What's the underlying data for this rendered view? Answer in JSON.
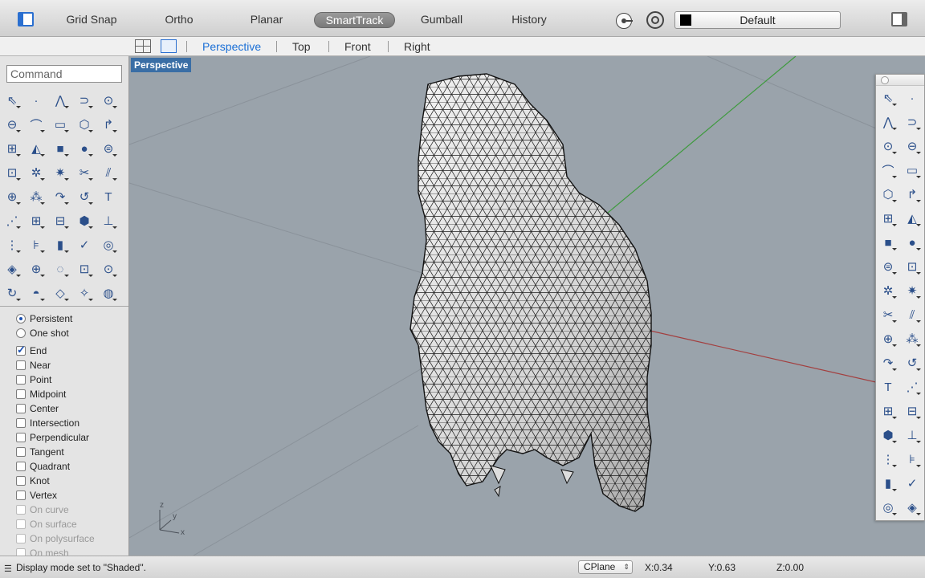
{
  "toolbar": {
    "buttons": [
      {
        "label": "Grid Snap",
        "active": false
      },
      {
        "label": "Ortho",
        "active": false
      },
      {
        "label": "Planar",
        "active": false
      },
      {
        "label": "SmartTrack",
        "active": true
      },
      {
        "label": "Gumball",
        "active": false
      },
      {
        "label": "History",
        "active": false
      }
    ],
    "layer": "Default"
  },
  "viewport_tabs": [
    "Perspective",
    "Top",
    "Front",
    "Right"
  ],
  "command": {
    "placeholder": "Command"
  },
  "osnap": {
    "modes": [
      {
        "label": "Persistent",
        "selected": true
      },
      {
        "label": "One shot",
        "selected": false
      }
    ],
    "items": [
      {
        "label": "End",
        "checked": true,
        "enabled": true
      },
      {
        "label": "Near",
        "checked": false,
        "enabled": true
      },
      {
        "label": "Point",
        "checked": false,
        "enabled": true
      },
      {
        "label": "Midpoint",
        "checked": false,
        "enabled": true
      },
      {
        "label": "Center",
        "checked": false,
        "enabled": true
      },
      {
        "label": "Intersection",
        "checked": false,
        "enabled": true
      },
      {
        "label": "Perpendicular",
        "checked": false,
        "enabled": true
      },
      {
        "label": "Tangent",
        "checked": false,
        "enabled": true
      },
      {
        "label": "Quadrant",
        "checked": false,
        "enabled": true
      },
      {
        "label": "Knot",
        "checked": false,
        "enabled": true
      },
      {
        "label": "Vertex",
        "checked": false,
        "enabled": true
      },
      {
        "label": "On curve",
        "checked": false,
        "enabled": false
      },
      {
        "label": "On surface",
        "checked": false,
        "enabled": false
      },
      {
        "label": "On polysurface",
        "checked": false,
        "enabled": false
      },
      {
        "label": "On mesh",
        "checked": false,
        "enabled": false
      }
    ]
  },
  "viewport": {
    "label": "Perspective",
    "axis_labels": {
      "z": "z",
      "y": "y",
      "x": "x"
    }
  },
  "left_tools": [
    "select-arrow-icon",
    "point-icon",
    "polyline-icon",
    "curve-icon",
    "circle-icon",
    "ellipse-icon",
    "arc-icon",
    "rectangle-icon",
    "polygon-icon",
    "fillet-icon",
    "surface-points-icon",
    "surface-edge-icon",
    "box-icon",
    "sphere-icon",
    "cylinder-icon",
    "mesh-icon",
    "gear-icon",
    "explode-icon",
    "trim-icon",
    "split-icon",
    "boolean-icon",
    "group-icon",
    "curve-tools-icon",
    "rebuild-icon",
    "text-icon",
    "control-points-icon",
    "array-icon",
    "layout-icon",
    "block-icon",
    "dimension-icon",
    "grid-icon",
    "align-icon",
    "solid-tools-icon",
    "check-icon",
    "analyze-icon",
    "render-icon",
    "zoom-in-icon",
    "zoom-window-icon",
    "zoom-extents-icon",
    "zoom-selected-icon",
    "rotate-view-icon",
    "car-icon",
    "plane-icon",
    "light-color-icon",
    "light-bulb-icon"
  ],
  "left_tool_glyphs": [
    "⇖",
    "·",
    "⋀",
    "⊃",
    "⊙",
    "⊖",
    "⌒",
    "▭",
    "⬡",
    "↱",
    "⊞",
    "◭",
    "■",
    "●",
    "⊜",
    "⊡",
    "✲",
    "✷",
    "✂",
    "⫽",
    "⊕",
    "⁂",
    "↷",
    "↺",
    "T",
    "⋰",
    "⊞",
    "⊟",
    "⬢",
    "⊥",
    "⋮",
    "⊧",
    "▮",
    "✓",
    "◎",
    "◈",
    "⊕",
    "◌",
    "⊡",
    "⊙",
    "↻",
    "◓",
    "◇",
    "✧",
    "◍"
  ],
  "right_tools": [
    "select-arrow-icon",
    "point-icon",
    "polyline-icon",
    "curve-icon",
    "circle-icon",
    "ellipse-icon",
    "arc-icon",
    "rectangle-icon",
    "polygon-icon",
    "fillet-icon",
    "surface-points-icon",
    "surface-edge-icon",
    "box-icon",
    "sphere-icon",
    "cylinder-icon",
    "mesh-icon",
    "gear-icon",
    "explode-icon",
    "trim-icon",
    "split-icon",
    "boolean-icon",
    "group-icon",
    "curve-tools-icon",
    "rebuild-icon",
    "text-icon",
    "control-points-icon",
    "array-icon",
    "layout-icon",
    "block-icon",
    "dimension-icon",
    "grid-icon",
    "align-icon",
    "solid-tools-icon",
    "check-icon",
    "analyze-icon",
    "render-icon"
  ],
  "right_tool_glyphs": [
    "⇖",
    "·",
    "⋀",
    "⊃",
    "⊙",
    "⊖",
    "⌒",
    "▭",
    "⬡",
    "↱",
    "⊞",
    "◭",
    "■",
    "●",
    "⊜",
    "⊡",
    "✲",
    "✷",
    "✂",
    "⫽",
    "⊕",
    "⁂",
    "↷",
    "↺",
    "T",
    "⋰",
    "⊞",
    "⊟",
    "⬢",
    "⊥",
    "⋮",
    "⊧",
    "▮",
    "✓",
    "◎",
    "◈"
  ],
  "status": {
    "message": "Display mode set to \"Shaded\".",
    "cplane": "CPlane",
    "x": "X:0.34",
    "y": "Y:0.63",
    "z": "Z:0.00"
  }
}
